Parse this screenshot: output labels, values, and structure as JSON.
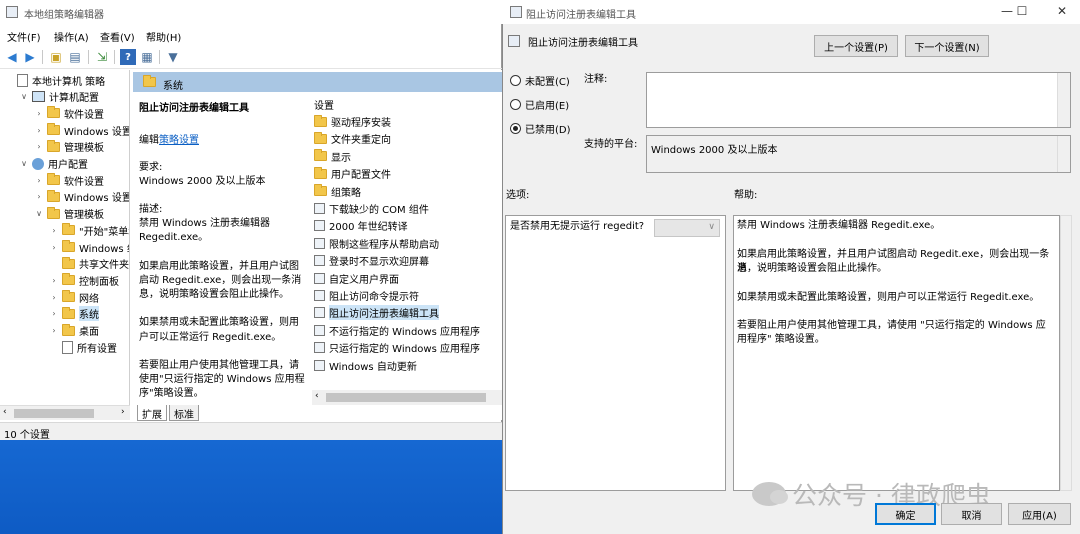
{
  "gpe": {
    "title": "本地组策略编辑器",
    "menu": [
      "文件(F)",
      "操作(A)",
      "查看(V)",
      "帮助(H)"
    ],
    "tree": [
      {
        "label": "本地计算机 策略",
        "indent": 0,
        "toggle": "",
        "icon": "doc"
      },
      {
        "label": "计算机配置",
        "indent": 1,
        "toggle": "∨",
        "icon": "pc"
      },
      {
        "label": "软件设置",
        "indent": 2,
        "toggle": "›",
        "icon": "folder"
      },
      {
        "label": "Windows 设置",
        "indent": 2,
        "toggle": "›",
        "icon": "folder"
      },
      {
        "label": "管理模板",
        "indent": 2,
        "toggle": "›",
        "icon": "folder"
      },
      {
        "label": "用户配置",
        "indent": 1,
        "toggle": "∨",
        "icon": "user"
      },
      {
        "label": "软件设置",
        "indent": 2,
        "toggle": "›",
        "icon": "folder"
      },
      {
        "label": "Windows 设置",
        "indent": 2,
        "toggle": "›",
        "icon": "folder"
      },
      {
        "label": "管理模板",
        "indent": 2,
        "toggle": "∨",
        "icon": "folder"
      },
      {
        "label": "\"开始\"菜单和",
        "indent": 3,
        "toggle": "›",
        "icon": "folder"
      },
      {
        "label": "Windows 组",
        "indent": 3,
        "toggle": "›",
        "icon": "folder"
      },
      {
        "label": "共享文件夹",
        "indent": 3,
        "toggle": "",
        "icon": "folder"
      },
      {
        "label": "控制面板",
        "indent": 3,
        "toggle": "›",
        "icon": "folder"
      },
      {
        "label": "网络",
        "indent": 3,
        "toggle": "›",
        "icon": "folder"
      },
      {
        "label": "系统",
        "indent": 3,
        "toggle": "›",
        "icon": "folder",
        "selected": true
      },
      {
        "label": "桌面",
        "indent": 3,
        "toggle": "›",
        "icon": "folder"
      },
      {
        "label": "所有设置",
        "indent": 3,
        "toggle": "",
        "icon": "doc"
      }
    ],
    "header": "系统",
    "description": {
      "title": "阻止访问注册表编辑工具",
      "edit_prefix": "编辑",
      "edit_link": "策略设置",
      "requirements_label": "要求:",
      "requirements_value": "Windows 2000 及以上版本",
      "desc_label": "描述:",
      "desc_lines": [
        "禁用 Windows 注册表编辑器",
        "Regedit.exe。",
        "",
        "如果启用此策略设置，并且用户试图",
        "启动 Regedit.exe，则会出现一条消",
        "息，说明策略设置会阻止此操作。",
        "",
        "如果禁用或未配置此策略设置，则用",
        "户可以正常运行 Regedit.exe。",
        "",
        "若要阻止用户使用其他管理工具，请",
        "使用\"只运行指定的 Windows 应用程",
        "序\"策略设置。"
      ]
    },
    "settings_header": "设置",
    "settings": [
      {
        "label": "驱动程序安装",
        "icon": "folder"
      },
      {
        "label": "文件夹重定向",
        "icon": "folder"
      },
      {
        "label": "显示",
        "icon": "folder"
      },
      {
        "label": "用户配置文件",
        "icon": "folder"
      },
      {
        "label": "组策略",
        "icon": "folder"
      },
      {
        "label": "下载缺少的 COM 组件",
        "icon": "policy"
      },
      {
        "label": "2000 年世纪转译",
        "icon": "policy"
      },
      {
        "label": "限制这些程序从帮助启动",
        "icon": "policy"
      },
      {
        "label": "登录时不显示欢迎屏幕",
        "icon": "policy"
      },
      {
        "label": "自定义用户界面",
        "icon": "policy"
      },
      {
        "label": "阻止访问命令提示符",
        "icon": "policy"
      },
      {
        "label": "阻止访问注册表编辑工具",
        "icon": "policy",
        "selected": true
      },
      {
        "label": "不运行指定的 Windows 应用程序",
        "icon": "policy"
      },
      {
        "label": "只运行指定的 Windows 应用程序",
        "icon": "policy"
      },
      {
        "label": "Windows 自动更新",
        "icon": "policy"
      }
    ],
    "tabs": [
      "扩展",
      "标准"
    ],
    "status": "10 个设置"
  },
  "dialog": {
    "title": "阻止访问注册表编辑工具",
    "policy_name": "阻止访问注册表编辑工具",
    "prev_button": "上一个设置(P)",
    "next_button": "下一个设置(N)",
    "radios": [
      "未配置(C)",
      "已启用(E)",
      "已禁用(D)"
    ],
    "selected_radio": 2,
    "comment_label": "注释:",
    "comment_value": "",
    "platform_label": "支持的平台:",
    "platform_value": "Windows 2000 及以上版本",
    "options_label": "选项:",
    "help_label": "帮助:",
    "option_question": "是否禁用无提示运行 regedit?",
    "help_lines": [
      "禁用 Windows 注册表编辑器 Regedit.exe。",
      "",
      "如果启用此策略设置，并且用户试图启动 Regedit.exe，则会出现一条消",
      "息，说明策略设置会阻止此操作。",
      "",
      "如果禁用或未配置此策略设置，则用户可以正常运行 Regedit.exe。",
      "",
      "若要阻止用户使用其他管理工具，请使用 \"只运行指定的 Windows 应",
      "用程序\" 策略设置。"
    ],
    "ok_button": "确定",
    "cancel_button": "取消",
    "apply_button": "应用(A)"
  },
  "watermark": "公众号 · 律政爬虫"
}
